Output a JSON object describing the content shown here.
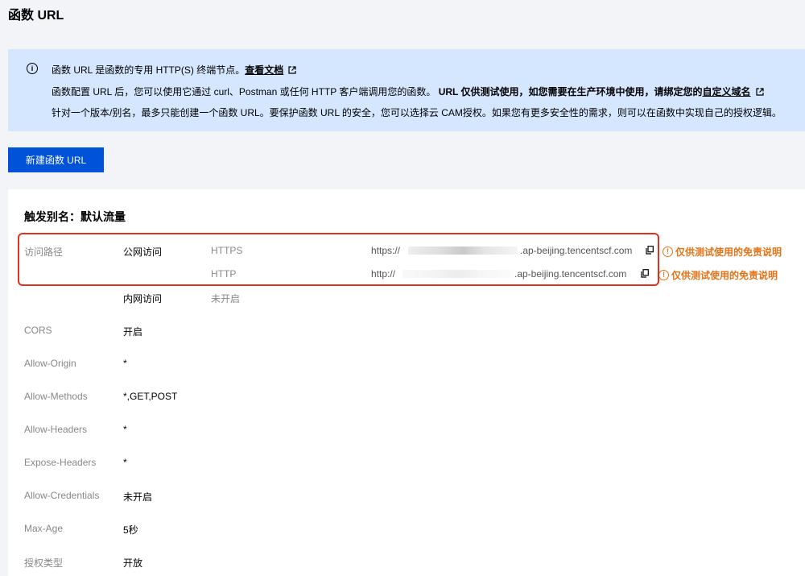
{
  "page_title": "函数 URL",
  "banner": {
    "icon": "info-icon",
    "line1_text": "函数 URL 是函数的专用 HTTP(S) 终端节点。",
    "line1_link": "查看文档",
    "line2_text": "函数配置 URL 后，您可以使用它通过 curl、Postman 或任何 HTTP 客户端调用您的函数。",
    "line2_bold": "URL 仅供测试使用，如您需要在生产环境中使用，请绑定您的",
    "line2_link": "自定义域名",
    "line3_text": "针对一个版本/别名，最多只能创建一个函数 URL。要保护函数 URL 的安全，您可以选择云 CAM授权。如果您有更多安全性的需求，则可以在函数中实现自己的授权逻辑。"
  },
  "create_button": "新建函数 URL",
  "card": {
    "title": "触发别名：默认流量",
    "access": {
      "label": "访问路径",
      "public_label": "公网访问",
      "https_proto": "HTTPS",
      "https_prefix": "https://",
      "https_suffix": ".ap-beijing.tencentscf.com",
      "http_proto": "HTTP",
      "http_prefix": "http://",
      "http_suffix": ".ap-beijing.tencentscf.com",
      "warning": "仅供测试使用的免责说明",
      "private_label": "内网访问",
      "private_value": "未开启"
    },
    "fields": [
      {
        "label": "CORS",
        "value": "开启"
      },
      {
        "label": "Allow-Origin",
        "value": "*"
      },
      {
        "label": "Allow-Methods",
        "value": "*,GET,POST"
      },
      {
        "label": "Allow-Headers",
        "value": "*"
      },
      {
        "label": "Expose-Headers",
        "value": "*"
      },
      {
        "label": "Allow-Credentials",
        "value": "未开启"
      },
      {
        "label": "Max-Age",
        "value": "5秒"
      },
      {
        "label": "授权类型",
        "value": "开放"
      }
    ]
  },
  "colors": {
    "primary": "#0052d9",
    "banner_bg": "#d5e7ff",
    "warning": "#e37318",
    "highlight": "#e0301e"
  }
}
